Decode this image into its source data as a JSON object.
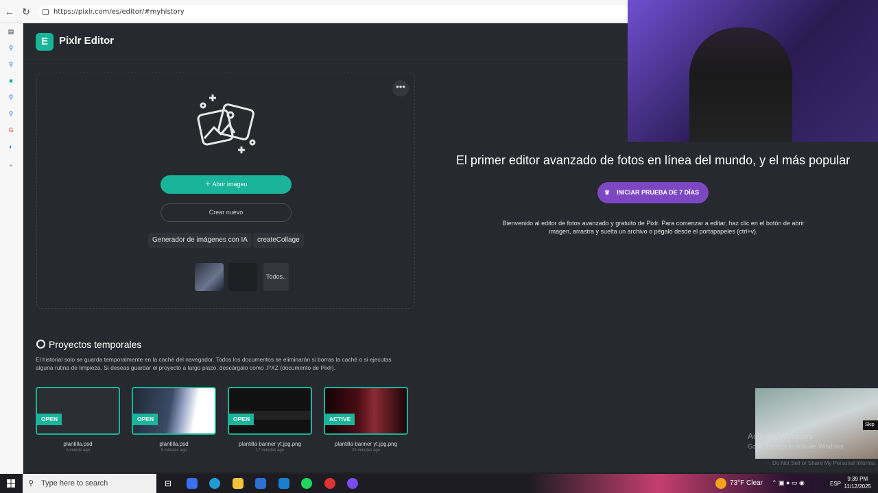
{
  "browser": {
    "url": "https://pixlr.com/es/editor/#myhistory"
  },
  "app": {
    "title": "Pixlr Editor",
    "logo_letter": "E"
  },
  "open_panel": {
    "open_image_label": "Abrir imagen",
    "create_new_label": "Crear nuevo",
    "chip_ai": "Generador de imágenes con IA",
    "chip_collage": "createCollage",
    "all_label": "Todos.."
  },
  "promo": {
    "title": "El primer editor avanzado de fotos en línea del mundo, y el más popular",
    "trial_label": "INICIAR PRUEBA DE 7 DÍAS",
    "description": "Bienvenido al editor de fotos avanzado y gratuito de Pixlr. Para comenzar a editar, haz clic en el botón de abrir imagen, arrastra y suelta un archivo o pégalo desde el portapapeles (ctrl+v)."
  },
  "history": {
    "title": "Proyectos temporales",
    "note": "El historial solo se guarda temporalmente en la caché del navegador. Todos los documentos se eliminarán si borras la caché o si ejecutas alguna rutina de limpieza. Si deseas guardar el proyecto a largo plazo, descárgalo como .PXZ (documento de Pixlr).",
    "projects": [
      {
        "badge": "OPEN",
        "name": "plantilla.psd",
        "time": "A minute ago"
      },
      {
        "badge": "OPEN",
        "name": "plantilla.psd",
        "time": "9 minutes ago"
      },
      {
        "badge": "OPEN",
        "name": "plantilla banner yt.jpg.png",
        "time": "17 minutes ago"
      },
      {
        "badge": "ACTIVE",
        "name": "plantilla banner yt.jpg.png",
        "time": "23 minutes ago"
      }
    ]
  },
  "overlay": {
    "skip_label": "Skip",
    "activate_title": "Activate Windows",
    "activate_sub": "Go to Settings to activate Windows.",
    "dnsm": "Do Not Sell or Share My Personal Informa"
  },
  "taskbar": {
    "search_placeholder": "Type here to search",
    "weather": "73°F  Clear",
    "lang": "ESP",
    "time": "9:39 PM",
    "date": "11/12/2025"
  },
  "colors": {
    "accent": "#19b49a",
    "trial": "#7d47c4",
    "app_bg": "#26292d"
  }
}
